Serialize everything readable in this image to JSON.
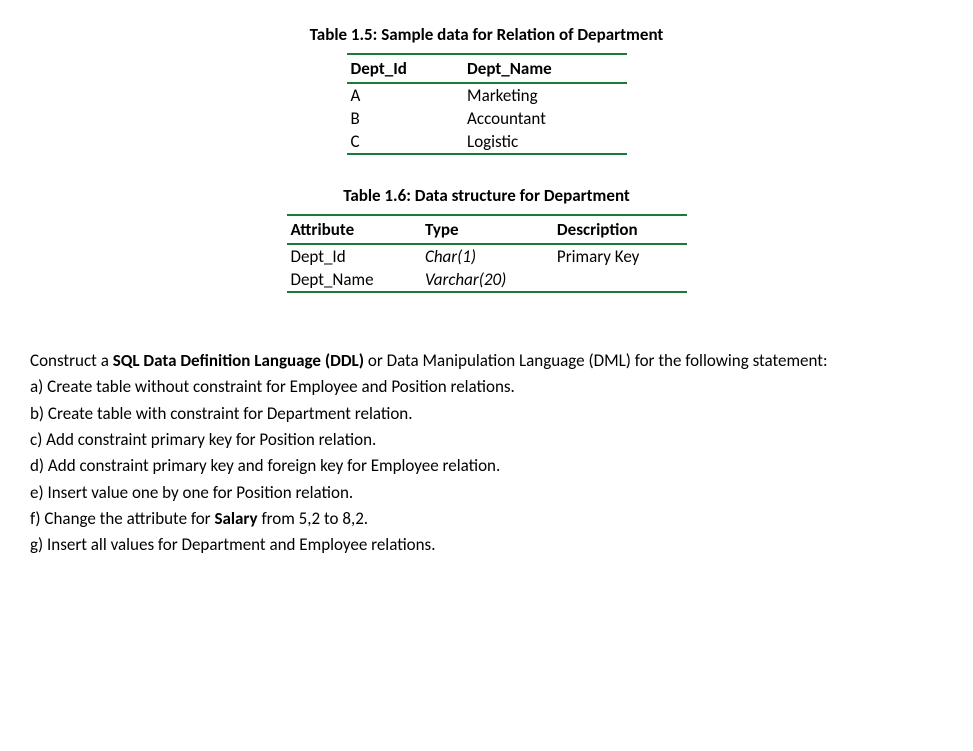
{
  "table15": {
    "caption": "Table 1.5: Sample data for Relation of Department",
    "headers": [
      "Dept_Id",
      "Dept_Name"
    ],
    "rows": [
      [
        "A",
        "Marketing"
      ],
      [
        "B",
        "Accountant"
      ],
      [
        "C",
        "Logistic"
      ]
    ]
  },
  "table16": {
    "caption": "Table 1.6: Data structure for Department",
    "headers": [
      "Attribute",
      "Type",
      "Description"
    ],
    "rows": [
      [
        "Dept_Id",
        "Char(1)",
        "Primary Key"
      ],
      [
        "Dept_Name",
        "Varchar(20)",
        ""
      ]
    ]
  },
  "instr": {
    "lead_pre": "Construct a ",
    "lead_bold": "SQL Data Definition Language (DDL)",
    "lead_post": " or Data Manipulation Language (DML) for the following statement:",
    "a": "a) Create table without constraint for Employee and Position relations.",
    "b": "b) Create table with constraint for Department relation.",
    "c": "c) Add constraint primary key for Position relation.",
    "d": "d) Add constraint primary key and foreign key for Employee relation.",
    "e": "e) Insert value one by one for Position relation.",
    "f_pre": "f) Change the attribute for ",
    "f_bold": "Salary",
    "f_post": " from 5,2 to 8,2.",
    "g": "g) Insert all values for Department and Employee relations."
  }
}
